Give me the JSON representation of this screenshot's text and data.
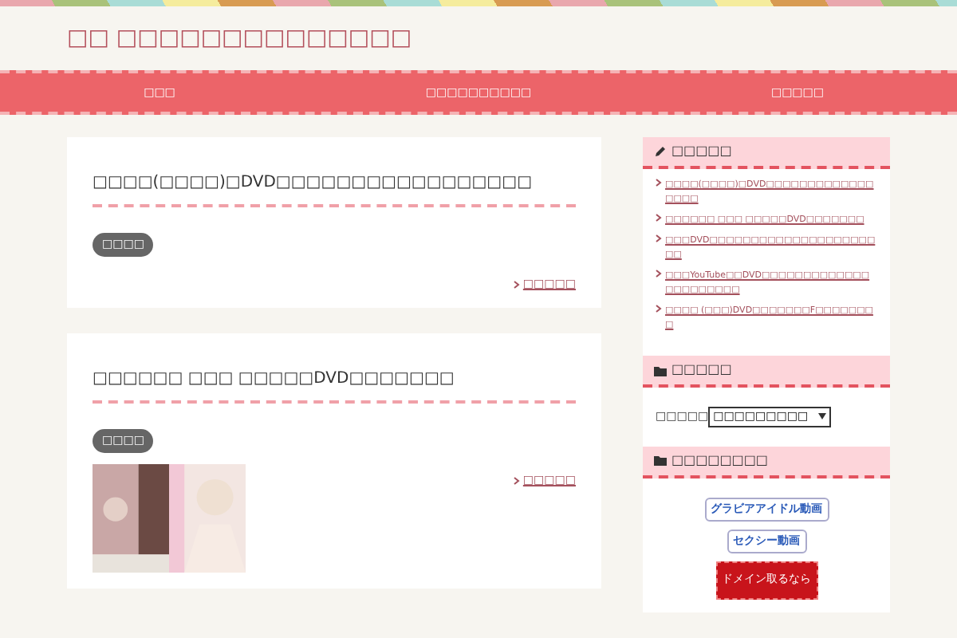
{
  "site_title": "□□ □□□□□□□□□□□□□□",
  "nav": [
    "□□□",
    "□□□□□□□□□□",
    "□□□□□"
  ],
  "posts": [
    {
      "title": "□□□□(□□□□)□DVD□□□□□□□□□□□□□□□□□",
      "category": "□□□□",
      "more": "□□□□□",
      "has_image": false
    },
    {
      "title": "□□□□□□ □□□ □□□□□DVD□□□□□□□",
      "category": "□□□□",
      "more": "□□□□□",
      "has_image": true
    }
  ],
  "sidebar": {
    "recent": {
      "heading": "□□□□□",
      "items": [
        "□□□□(□□□□)□DVD□□□□□□□□□□□□□□□□□",
        "□□□□□□ □□□ □□□□□DVD□□□□□□□",
        "□□□DVD□□□□□□□□□□□□□□□□□□□□□□",
        "□□□YouTube□□DVD□□□□□□□□□□□□□□□□□□□□□□",
        "□□□□ (□□□)DVD□□□□□□□F□□□□□□□□"
      ]
    },
    "categories": {
      "heading": "□□□□□",
      "label": "□□□□□",
      "select": "□□□□□□□□□"
    },
    "links": {
      "heading": "□□□□□□□□",
      "banners": [
        {
          "kind": "small",
          "text": "グラビアアイドル動画"
        },
        {
          "kind": "small",
          "text": "セクシー動画"
        },
        {
          "kind": "large",
          "text": "ドメイン取るなら"
        }
      ]
    }
  }
}
